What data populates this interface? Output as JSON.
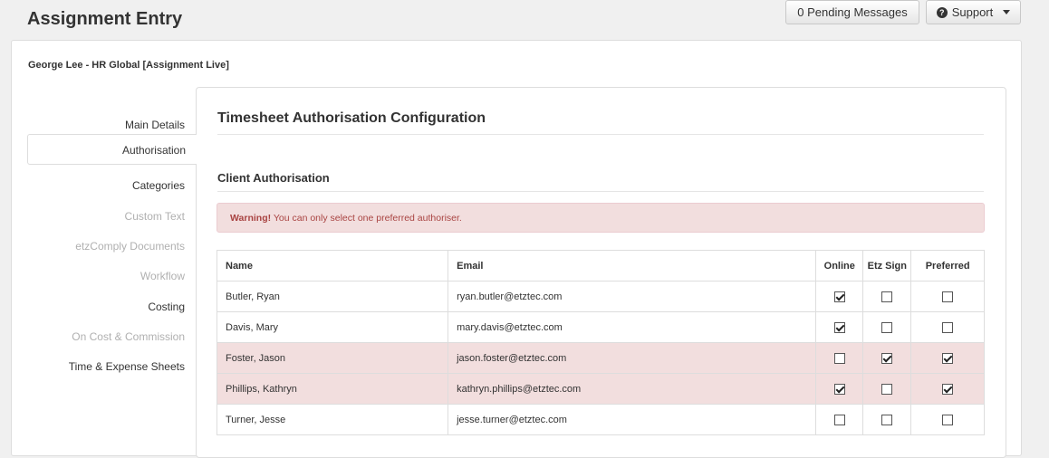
{
  "page": {
    "title": "Assignment Entry"
  },
  "header": {
    "pending_label": "0 Pending Messages",
    "support_label": "Support"
  },
  "assignee": "George Lee - HR Global [Assignment Live]",
  "sidebar": {
    "items": [
      {
        "label": "Main Details",
        "enabled": true
      },
      {
        "label": "Authorisation",
        "enabled": true,
        "active": true
      },
      {
        "label": "Categories",
        "enabled": true
      },
      {
        "label": "Custom Text",
        "enabled": false
      },
      {
        "label": "etzComply Documents",
        "enabled": false
      },
      {
        "label": "Workflow",
        "enabled": false
      },
      {
        "label": "Costing",
        "enabled": true
      },
      {
        "label": "On Cost & Commission",
        "enabled": false
      },
      {
        "label": "Time & Expense Sheets",
        "enabled": true
      }
    ]
  },
  "main": {
    "title": "Timesheet Authorisation Configuration",
    "subtitle": "Client Authorisation",
    "warning": {
      "strong": "Warning!",
      "text": " You can only select one preferred authoriser."
    },
    "table": {
      "headers": [
        "Name",
        "Email",
        "Online",
        "Etz Sign",
        "Preferred"
      ],
      "rows": [
        {
          "name": "Butler, Ryan",
          "email": "ryan.butler@etztec.com",
          "online": true,
          "etzsign": false,
          "preferred": false
        },
        {
          "name": "Davis, Mary",
          "email": "mary.davis@etztec.com",
          "online": true,
          "etzsign": false,
          "preferred": false
        },
        {
          "name": "Foster, Jason",
          "email": "jason.foster@etztec.com",
          "online": false,
          "etzsign": true,
          "preferred": true
        },
        {
          "name": "Phillips, Kathryn",
          "email": "kathryn.phillips@etztec.com",
          "online": true,
          "etzsign": false,
          "preferred": true
        },
        {
          "name": "Turner, Jesse",
          "email": "jesse.turner@etztec.com",
          "online": false,
          "etzsign": false,
          "preferred": false
        }
      ]
    }
  },
  "colors": {
    "warning_bg": "#f2dede",
    "warning_text": "#a94442",
    "disabled_nav": "#b0b0b0"
  }
}
